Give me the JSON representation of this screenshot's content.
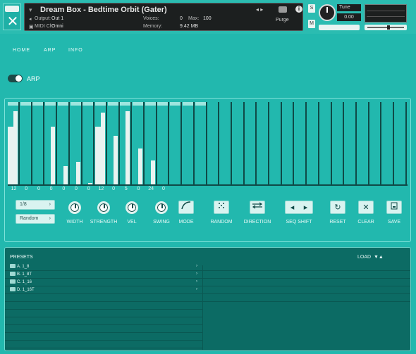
{
  "header": {
    "title": "Dream Box - Bedtime Orbit (Gater)",
    "output_label": "Output:",
    "output_value": "Out 1",
    "midi_label": "MIDI Ch:",
    "midi_value": "Omni",
    "voices_label": "Voices:",
    "voices_value": "0",
    "max_label": "Max:",
    "max_value": "100",
    "memory_label": "Memory:",
    "memory_value": "9.42 MB",
    "purge_label": "Purge",
    "tune_label": "Tune",
    "tune_value": "0.00"
  },
  "tabs": [
    {
      "label": "HOME"
    },
    {
      "label": "ARP"
    },
    {
      "label": "INFO"
    }
  ],
  "arp": {
    "label": "ARP",
    "enabled": true
  },
  "sequencer": {
    "active_steps": 16,
    "total_steps": 32,
    "bars": [
      {
        "left": 0.77,
        "right": 0.97
      },
      {
        "left": 0.0,
        "right": 0.0
      },
      {
        "left": 0.0,
        "right": 0.0
      },
      {
        "left": 0.0,
        "right": 0.77
      },
      {
        "left": 0.0,
        "right": 0.25
      },
      {
        "left": 0.0,
        "right": 0.31
      },
      {
        "left": 0.0,
        "right": 0.03
      },
      {
        "left": 0.77,
        "right": 0.95
      },
      {
        "left": 0.0,
        "right": 0.65
      },
      {
        "left": 0.0,
        "right": 0.97
      },
      {
        "left": 0.0,
        "right": 0.48
      },
      {
        "left": 0.0,
        "right": 0.32
      },
      {
        "left": 0.0,
        "right": 0.0
      },
      {
        "left": 0.0,
        "right": 0.0
      },
      {
        "left": 0.0,
        "right": 0.0
      },
      {
        "left": 0.0,
        "right": 0.0
      }
    ],
    "step_labels": [
      "12",
      "0",
      "0",
      "0",
      "0",
      "0",
      "0",
      "12",
      "0",
      "5",
      "0",
      "24",
      "0"
    ],
    "rate": "1/8",
    "mode": "Random",
    "knobs": [
      {
        "label": "WIDTH"
      },
      {
        "label": "STRENGTH"
      },
      {
        "label": "VEL"
      },
      {
        "label": "SWING"
      }
    ],
    "buttons": [
      {
        "label": "MODE"
      },
      {
        "label": "RANDOM"
      },
      {
        "label": "DIRECTION"
      },
      {
        "label": "SEQ SHIFT"
      },
      {
        "label": "RESET"
      },
      {
        "label": "CLEAR"
      },
      {
        "label": "SAVE"
      }
    ]
  },
  "presets": {
    "title": "PRESETS",
    "load_label": "LOAD",
    "items": [
      {
        "label": "A. 1_8"
      },
      {
        "label": "B. 1_8T"
      },
      {
        "label": "C. 1_16"
      },
      {
        "label": "D. 1_16T"
      }
    ]
  },
  "colors": {
    "background": "#22b8ae",
    "bar": "#e9f3f1",
    "divider": "#0f4a47",
    "preset_panel": "#0c6b64"
  },
  "icons": [
    "close-x-logo",
    "camera-icon",
    "info-icon",
    "tune-knob",
    "toggle",
    "mode-curve-icon",
    "dice-icon",
    "direction-icon",
    "shift-arrows-icon",
    "reset-icon",
    "clear-icon",
    "save-icon",
    "folder-icon",
    "chevron-right-icon",
    "triangle-down-icon",
    "triangle-up-icon"
  ]
}
